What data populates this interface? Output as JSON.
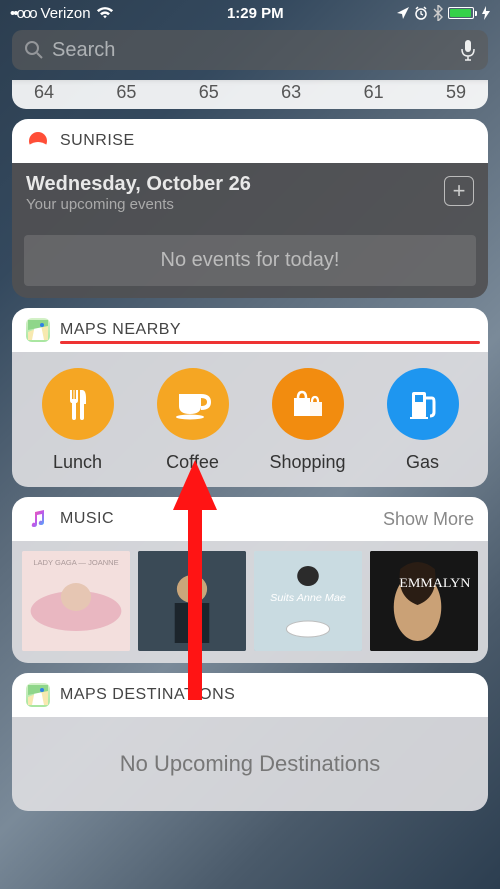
{
  "status": {
    "signal_dots": "••ooo",
    "carrier": "Verizon",
    "time": "1:29 PM"
  },
  "search": {
    "placeholder": "Search"
  },
  "weather_temps": [
    "64",
    "65",
    "65",
    "63",
    "61",
    "59"
  ],
  "sunrise": {
    "title": "SUNRISE",
    "date": "Wednesday, October 26",
    "subtitle": "Your upcoming events",
    "empty": "No events for today!",
    "add_label": "+"
  },
  "maps_nearby": {
    "title": "MAPS NEARBY",
    "items": [
      {
        "label": "Lunch",
        "icon": "fork-knife",
        "color": "c-orange"
      },
      {
        "label": "Coffee",
        "icon": "cup",
        "color": "c-orange"
      },
      {
        "label": "Shopping",
        "icon": "bags",
        "color": "c-orange2"
      },
      {
        "label": "Gas",
        "icon": "pump",
        "color": "c-blue"
      }
    ]
  },
  "music": {
    "title": "MUSIC",
    "action": "Show More",
    "albums": [
      "LADY GAGA — JOANNE",
      "",
      "Suits Anne Mae",
      "EMMALYN"
    ]
  },
  "destinations": {
    "title": "MAPS DESTINATIONS",
    "empty": "No Upcoming Destinations"
  }
}
